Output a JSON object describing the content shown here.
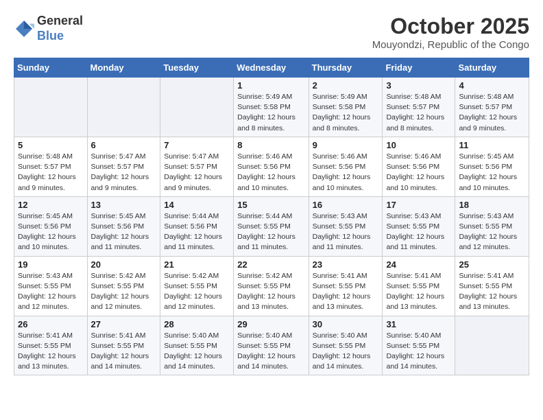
{
  "header": {
    "logo_general": "General",
    "logo_blue": "Blue",
    "month_title": "October 2025",
    "location": "Mouyondzi, Republic of the Congo"
  },
  "days_of_week": [
    "Sunday",
    "Monday",
    "Tuesday",
    "Wednesday",
    "Thursday",
    "Friday",
    "Saturday"
  ],
  "weeks": [
    [
      {
        "day": "",
        "info": ""
      },
      {
        "day": "",
        "info": ""
      },
      {
        "day": "",
        "info": ""
      },
      {
        "day": "1",
        "info": "Sunrise: 5:49 AM\nSunset: 5:58 PM\nDaylight: 12 hours\nand 8 minutes."
      },
      {
        "day": "2",
        "info": "Sunrise: 5:49 AM\nSunset: 5:58 PM\nDaylight: 12 hours\nand 8 minutes."
      },
      {
        "day": "3",
        "info": "Sunrise: 5:48 AM\nSunset: 5:57 PM\nDaylight: 12 hours\nand 8 minutes."
      },
      {
        "day": "4",
        "info": "Sunrise: 5:48 AM\nSunset: 5:57 PM\nDaylight: 12 hours\nand 9 minutes."
      }
    ],
    [
      {
        "day": "5",
        "info": "Sunrise: 5:48 AM\nSunset: 5:57 PM\nDaylight: 12 hours\nand 9 minutes."
      },
      {
        "day": "6",
        "info": "Sunrise: 5:47 AM\nSunset: 5:57 PM\nDaylight: 12 hours\nand 9 minutes."
      },
      {
        "day": "7",
        "info": "Sunrise: 5:47 AM\nSunset: 5:57 PM\nDaylight: 12 hours\nand 9 minutes."
      },
      {
        "day": "8",
        "info": "Sunrise: 5:46 AM\nSunset: 5:56 PM\nDaylight: 12 hours\nand 10 minutes."
      },
      {
        "day": "9",
        "info": "Sunrise: 5:46 AM\nSunset: 5:56 PM\nDaylight: 12 hours\nand 10 minutes."
      },
      {
        "day": "10",
        "info": "Sunrise: 5:46 AM\nSunset: 5:56 PM\nDaylight: 12 hours\nand 10 minutes."
      },
      {
        "day": "11",
        "info": "Sunrise: 5:45 AM\nSunset: 5:56 PM\nDaylight: 12 hours\nand 10 minutes."
      }
    ],
    [
      {
        "day": "12",
        "info": "Sunrise: 5:45 AM\nSunset: 5:56 PM\nDaylight: 12 hours\nand 10 minutes."
      },
      {
        "day": "13",
        "info": "Sunrise: 5:45 AM\nSunset: 5:56 PM\nDaylight: 12 hours\nand 11 minutes."
      },
      {
        "day": "14",
        "info": "Sunrise: 5:44 AM\nSunset: 5:56 PM\nDaylight: 12 hours\nand 11 minutes."
      },
      {
        "day": "15",
        "info": "Sunrise: 5:44 AM\nSunset: 5:55 PM\nDaylight: 12 hours\nand 11 minutes."
      },
      {
        "day": "16",
        "info": "Sunrise: 5:43 AM\nSunset: 5:55 PM\nDaylight: 12 hours\nand 11 minutes."
      },
      {
        "day": "17",
        "info": "Sunrise: 5:43 AM\nSunset: 5:55 PM\nDaylight: 12 hours\nand 11 minutes."
      },
      {
        "day": "18",
        "info": "Sunrise: 5:43 AM\nSunset: 5:55 PM\nDaylight: 12 hours\nand 12 minutes."
      }
    ],
    [
      {
        "day": "19",
        "info": "Sunrise: 5:43 AM\nSunset: 5:55 PM\nDaylight: 12 hours\nand 12 minutes."
      },
      {
        "day": "20",
        "info": "Sunrise: 5:42 AM\nSunset: 5:55 PM\nDaylight: 12 hours\nand 12 minutes."
      },
      {
        "day": "21",
        "info": "Sunrise: 5:42 AM\nSunset: 5:55 PM\nDaylight: 12 hours\nand 12 minutes."
      },
      {
        "day": "22",
        "info": "Sunrise: 5:42 AM\nSunset: 5:55 PM\nDaylight: 12 hours\nand 13 minutes."
      },
      {
        "day": "23",
        "info": "Sunrise: 5:41 AM\nSunset: 5:55 PM\nDaylight: 12 hours\nand 13 minutes."
      },
      {
        "day": "24",
        "info": "Sunrise: 5:41 AM\nSunset: 5:55 PM\nDaylight: 12 hours\nand 13 minutes."
      },
      {
        "day": "25",
        "info": "Sunrise: 5:41 AM\nSunset: 5:55 PM\nDaylight: 12 hours\nand 13 minutes."
      }
    ],
    [
      {
        "day": "26",
        "info": "Sunrise: 5:41 AM\nSunset: 5:55 PM\nDaylight: 12 hours\nand 13 minutes."
      },
      {
        "day": "27",
        "info": "Sunrise: 5:41 AM\nSunset: 5:55 PM\nDaylight: 12 hours\nand 14 minutes."
      },
      {
        "day": "28",
        "info": "Sunrise: 5:40 AM\nSunset: 5:55 PM\nDaylight: 12 hours\nand 14 minutes."
      },
      {
        "day": "29",
        "info": "Sunrise: 5:40 AM\nSunset: 5:55 PM\nDaylight: 12 hours\nand 14 minutes."
      },
      {
        "day": "30",
        "info": "Sunrise: 5:40 AM\nSunset: 5:55 PM\nDaylight: 12 hours\nand 14 minutes."
      },
      {
        "day": "31",
        "info": "Sunrise: 5:40 AM\nSunset: 5:55 PM\nDaylight: 12 hours\nand 14 minutes."
      },
      {
        "day": "",
        "info": ""
      }
    ]
  ]
}
